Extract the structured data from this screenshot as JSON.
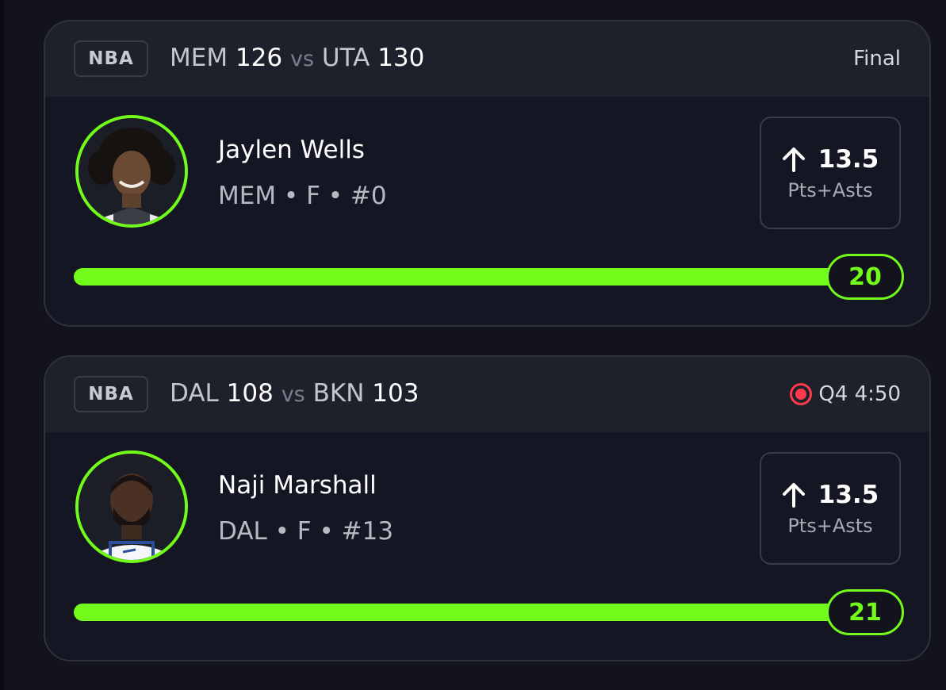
{
  "accent_color": "#72fb1a",
  "live_color": "#ff3a4a",
  "cards": [
    {
      "league": "NBA",
      "home_team": "MEM",
      "home_score": "126",
      "vs": "vs",
      "away_team": "UTA",
      "away_score": "130",
      "status": "Final",
      "live": false,
      "player": {
        "name": "Jaylen Wells",
        "meta": "MEM • F • #0",
        "avatar_icon": "player-headshot"
      },
      "line": {
        "direction_icon": "arrow-up-icon",
        "value": "13.5",
        "stat": "Pts+Asts"
      },
      "progress": {
        "current": "20",
        "fill_fraction": 1.0
      }
    },
    {
      "league": "NBA",
      "home_team": "DAL",
      "home_score": "108",
      "vs": "vs",
      "away_team": "BKN",
      "away_score": "103",
      "status": "Q4 4:50",
      "live": true,
      "player": {
        "name": "Naji Marshall",
        "meta": "DAL • F • #13",
        "avatar_icon": "player-headshot"
      },
      "line": {
        "direction_icon": "arrow-up-icon",
        "value": "13.5",
        "stat": "Pts+Asts"
      },
      "progress": {
        "current": "21",
        "fill_fraction": 1.0
      }
    }
  ]
}
